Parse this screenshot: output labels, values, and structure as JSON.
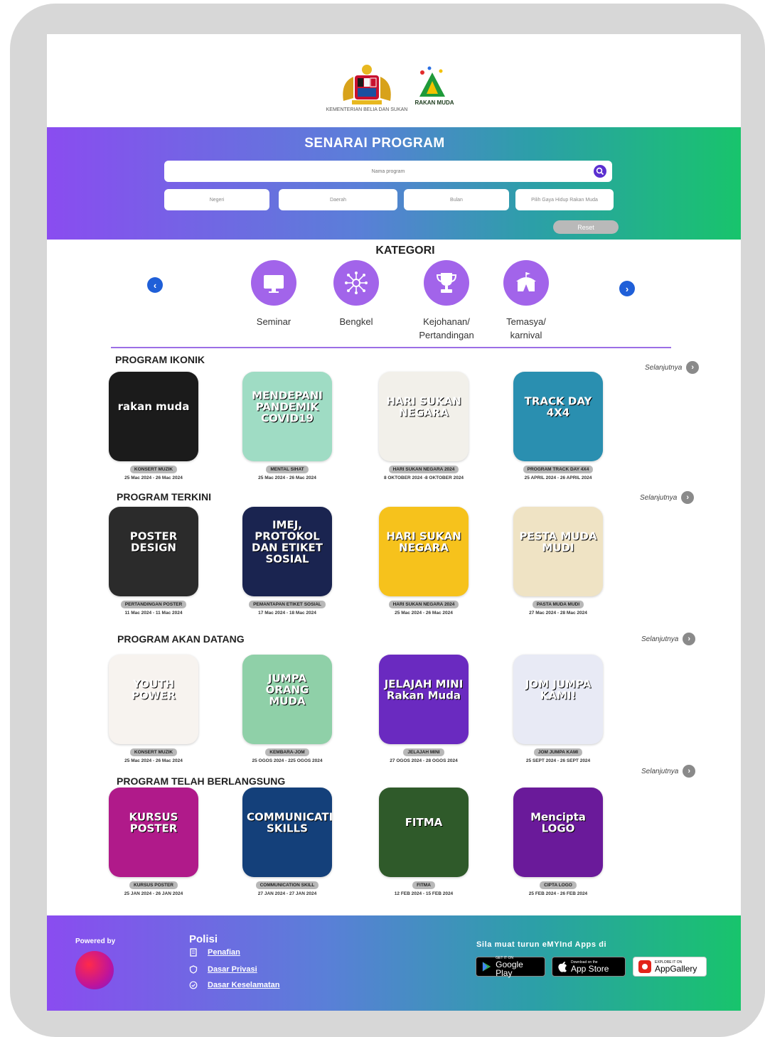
{
  "header": {
    "kbs_caption": "KEMENTERIAN BELIA DAN SUKAN",
    "rm_caption": "RAKAN MUDA"
  },
  "banner": {
    "title": "SENARAI PROGRAM",
    "search_placeholder": "Nama program",
    "filters": [
      "Negeri",
      "Daerah",
      "Bulan",
      "Pilih Gaya Hidup Rakan Muda"
    ],
    "reset_label": "Reset"
  },
  "kategori": {
    "title": "KATEGORI",
    "items": [
      {
        "label": "Seminar",
        "icon": "monitor-icon"
      },
      {
        "label": "Bengkel",
        "icon": "network-icon"
      },
      {
        "label": "Kejohanan/\nPertandingan",
        "icon": "trophy-icon"
      },
      {
        "label": "Temasya/\nkarnival",
        "icon": "tent-icon"
      }
    ]
  },
  "more_label": "Selanjutnya",
  "sections": [
    {
      "title": "PROGRAM IKONIK",
      "cards": [
        {
          "thumb_text": "rakan muda",
          "tag": "KONSERT MUZIK",
          "date": "25 Mac 2024 - 26 Mac 2024",
          "color": "#1b1b1b"
        },
        {
          "thumb_text": "MENDEPANI PANDEMIK COVID19",
          "tag": "MENTAL SIHAT",
          "date": "25 Mac 2024 - 26 Mac 2024",
          "color": "#9fdcc4"
        },
        {
          "thumb_text": "HARI SUKAN NEGARA",
          "tag": "HARI SUKAN NEGARA 2024",
          "date": "8 OKTOBER 2024 -8 OKTOBER 2024",
          "color": "#f2f0ea"
        },
        {
          "thumb_text": "TRACK DAY 4X4",
          "tag": "PROGRAM TRACK DAY 4X4",
          "date": "25 APRIL 2024 - 26 APRIL 2024",
          "color": "#2a8fb0"
        }
      ]
    },
    {
      "title": "PROGRAM TERKINI",
      "cards": [
        {
          "thumb_text": "POSTER DESIGN",
          "tag": "PERTANDINGAN POSTER",
          "date": "11 Mac 2024 - 11 Mac 2024",
          "color": "#2b2b2b"
        },
        {
          "thumb_text": "IMEJ, PROTOKOL DAN ETIKET SOSIAL",
          "tag": "PEMANTAPAN ETIKET SOSIAL",
          "date": "17 Mac 2024 - 18 Mac 2024",
          "color": "#1a2450"
        },
        {
          "thumb_text": "HARI SUKAN NEGARA",
          "tag": "HARI SUKAN NEGARA 2024",
          "date": "25 Mac 2024 - 26 Mac 2024",
          "color": "#f6c21c"
        },
        {
          "thumb_text": "PESTA MUDA MUDI",
          "tag": "PASTA MUDA MUDI",
          "date": "27 Mac 2024 - 28 Mac 2024",
          "color": "#efe3c4"
        }
      ]
    },
    {
      "title": "PROGRAM AKAN DATANG",
      "cards": [
        {
          "thumb_text": "YOUTH POWER",
          "tag": "KONSERT MUZIK",
          "date": "25 Mac 2024 - 26 Mac 2024",
          "color": "#f7f3ef"
        },
        {
          "thumb_text": "JUMPA ORANG MUDA",
          "tag": "KEMBARA-JOM",
          "date": "25 OGOS 2024 - 225 OGOS 2024",
          "color": "#8fd0a8"
        },
        {
          "thumb_text": "JELAJAH MINI Rakan Muda",
          "tag": "JELAJAH MINI",
          "date": "27 OGOS 2024 - 28 OGOS 2024",
          "color": "#6a2ac0"
        },
        {
          "thumb_text": "JOM JUMPA KAMI!",
          "tag": "JOM JUMPA KAMI",
          "date": "25 SEPT 2024 - 26 SEPT 2024",
          "color": "#e8eaf5"
        }
      ]
    },
    {
      "title": "PROGRAM TELAH BERLANGSUNG",
      "cards": [
        {
          "thumb_text": "KURSUS POSTER",
          "tag": "KURSUS POSTER",
          "date": "25 JAN 2024 - 26 JAN 2024",
          "color": "#b01a8a"
        },
        {
          "thumb_text": "COMMUNICATION SKILLS",
          "tag": "COMMUNICATION SKILL",
          "date": "27 JAN 2024 - 27 JAN 2024",
          "color": "#14407a"
        },
        {
          "thumb_text": "FITMA",
          "tag": "FITMA",
          "date": "12 FEB 2024 - 15 FEB 2024",
          "color": "#2f5a2a"
        },
        {
          "thumb_text": "Mencipta LOGO",
          "tag": "CIPTA LOGO",
          "date": "25 FEB 2024 - 26 FEB 2024",
          "color": "#6a1a9a"
        }
      ]
    }
  ],
  "footer": {
    "powered_by": "Powered by",
    "polisi_title": "Polisi",
    "links": [
      "Penafian",
      "Dasar Privasi",
      "Dasar Keselamatan"
    ],
    "apps_title": "Sila muat turun eMYInd Apps di",
    "badges": [
      {
        "small": "GET IT ON",
        "big": "Google Play"
      },
      {
        "small": "Download on the",
        "big": "App Store"
      },
      {
        "small": "EXPLORE IT ON",
        "big": "AppGallery"
      }
    ]
  }
}
